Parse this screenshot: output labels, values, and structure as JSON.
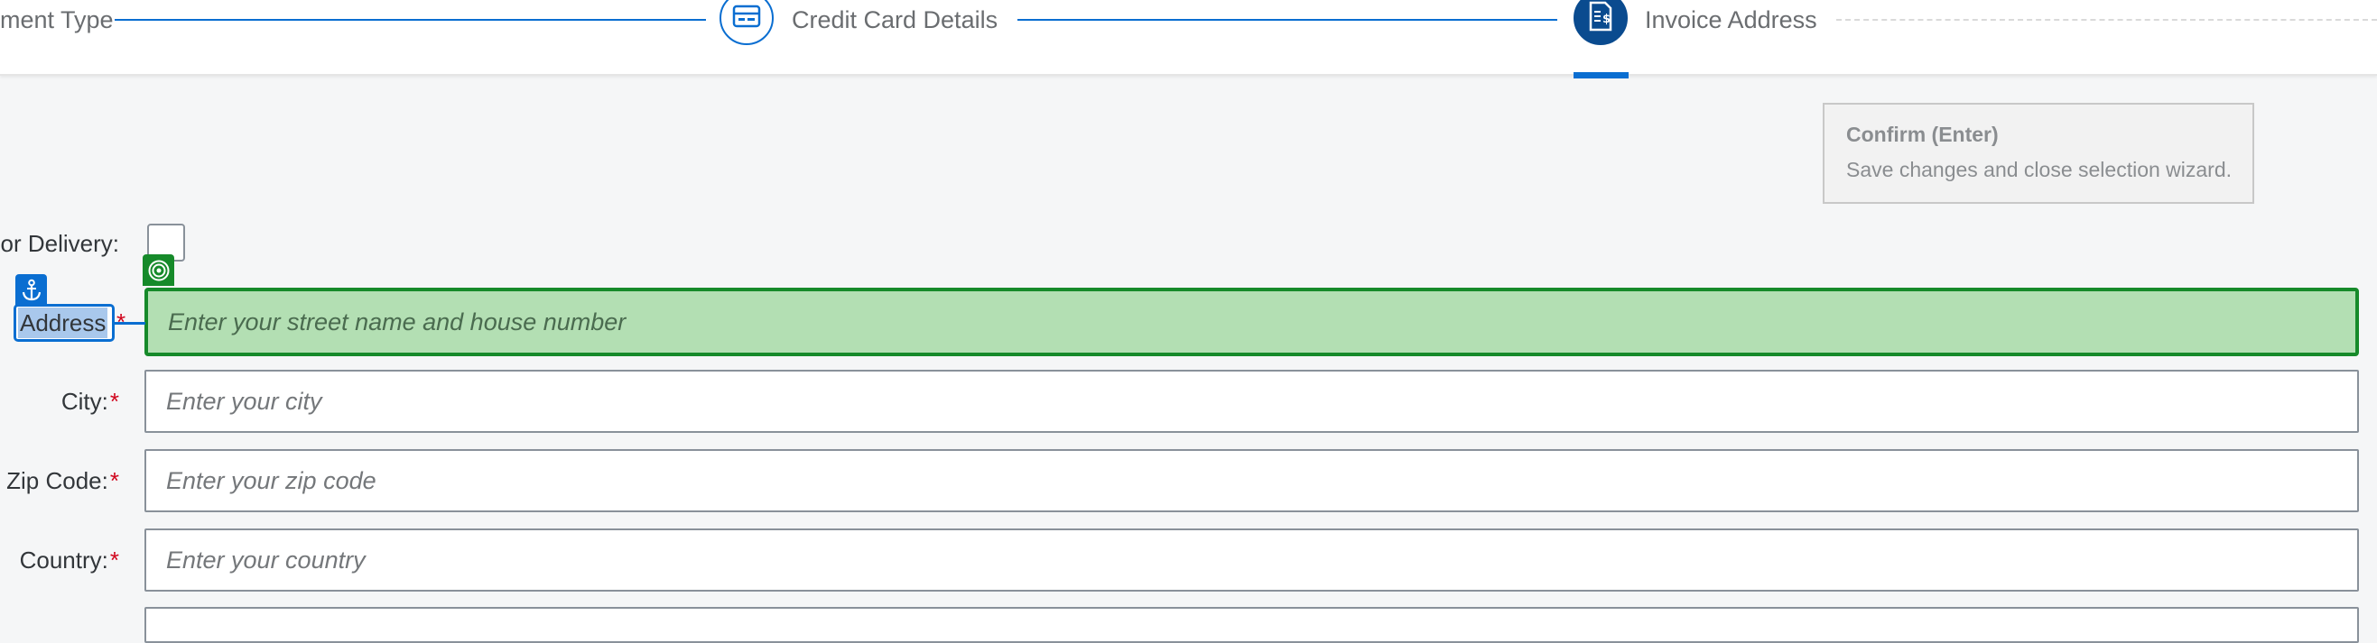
{
  "wizard": {
    "steps": [
      {
        "label": "Payment Type",
        "visible_label": "ment Type",
        "status": "done"
      },
      {
        "label": "Credit Card Details",
        "icon": "credit-card-icon",
        "status": "done"
      },
      {
        "label": "Invoice Address",
        "icon": "invoice-icon",
        "status": "current"
      }
    ]
  },
  "tooltip": {
    "title": "Confirm (Enter)",
    "description": "Save changes and close selection wizard."
  },
  "form": {
    "delivery_label": "or Delivery:",
    "address_label": "Address",
    "address_required": "*",
    "address_placeholder": "Enter your street name and house number",
    "city_label": "City:",
    "city_placeholder": "Enter your city",
    "zip_label": "Zip Code:",
    "zip_placeholder": "Enter your zip code",
    "country_label": "Country:",
    "country_placeholder": "Enter your country",
    "required_marker": "*"
  },
  "overlay": {
    "anchor_icon": "anchor-icon",
    "target_icon": "target-icon"
  },
  "colors": {
    "accent": "#0a6ed1",
    "current_step": "#0a4b8f",
    "highlight_fill": "#b3dfb3",
    "highlight_border": "#168a2a",
    "required": "#d0021b"
  }
}
